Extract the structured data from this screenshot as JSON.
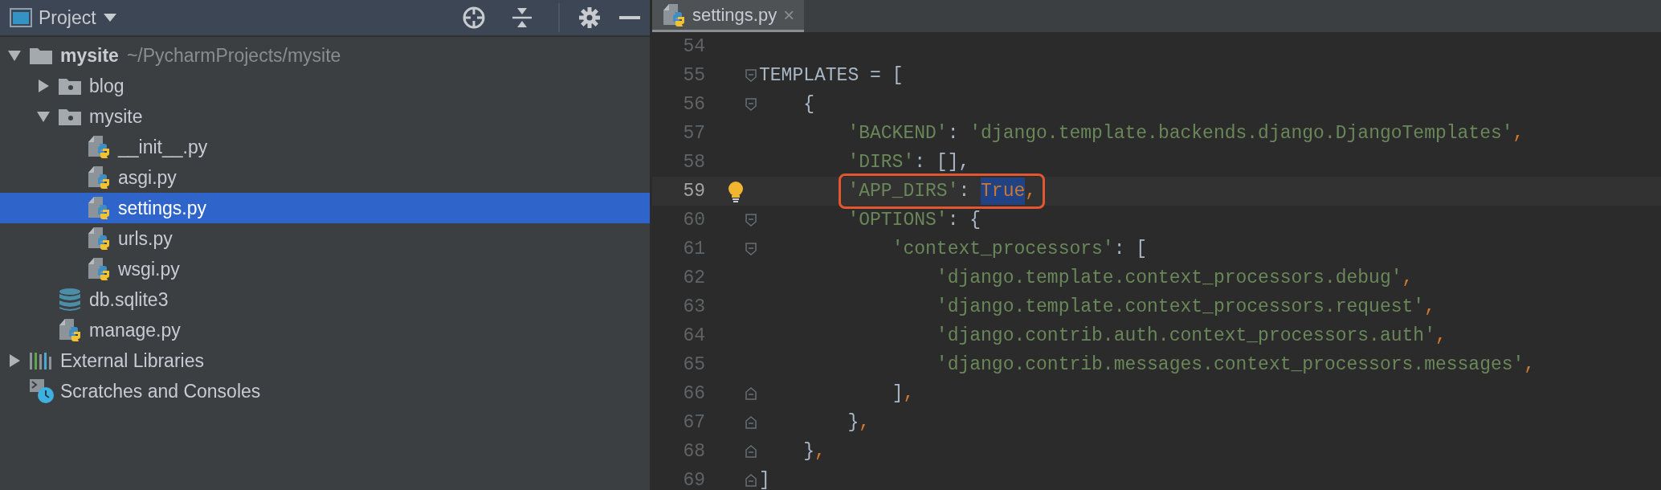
{
  "project_panel": {
    "title": "Project",
    "tree": [
      {
        "name": "mysite",
        "path": "~/PycharmProjects/mysite",
        "kind": "project-folder",
        "expanded": true,
        "selected": false,
        "children": [
          {
            "name": "blog",
            "kind": "package-folder",
            "expanded": false,
            "selected": false
          },
          {
            "name": "mysite",
            "kind": "package-folder",
            "expanded": true,
            "selected": false,
            "children": [
              {
                "name": "__init__.py",
                "kind": "python-file",
                "selected": false
              },
              {
                "name": "asgi.py",
                "kind": "python-file",
                "selected": false
              },
              {
                "name": "settings.py",
                "kind": "python-file",
                "selected": true
              },
              {
                "name": "urls.py",
                "kind": "python-file",
                "selected": false
              },
              {
                "name": "wsgi.py",
                "kind": "python-file",
                "selected": false
              }
            ]
          },
          {
            "name": "db.sqlite3",
            "kind": "database",
            "selected": false
          },
          {
            "name": "manage.py",
            "kind": "python-file",
            "selected": false
          }
        ]
      },
      {
        "name": "External Libraries",
        "kind": "libraries",
        "expanded": false,
        "selected": false
      },
      {
        "name": "Scratches and Consoles",
        "kind": "scratches",
        "selected": false
      }
    ]
  },
  "editor": {
    "tabs": [
      {
        "label": "settings.py",
        "close": "×",
        "selected": true
      }
    ],
    "lines": [
      {
        "number": "54"
      },
      {
        "number": "55",
        "fold_open": true,
        "tokens": [
          {
            "kind": "plain",
            "text": "TEMPLATES = ["
          }
        ]
      },
      {
        "number": "56",
        "fold_open": true,
        "tokens": [
          {
            "kind": "plain",
            "text": "{"
          }
        ]
      },
      {
        "number": "57",
        "tokens": [
          {
            "kind": "string",
            "text": "'BACKEND'"
          },
          {
            "kind": "plain",
            "text": ": "
          },
          {
            "kind": "string",
            "text": "'django.template.backends.django.DjangoTemplates'"
          },
          {
            "kind": "keyword",
            "text": ","
          }
        ]
      },
      {
        "number": "58",
        "tokens": [
          {
            "kind": "string",
            "text": "'DIRS'"
          },
          {
            "kind": "plain",
            "text": ": [],"
          }
        ]
      },
      {
        "number": "59",
        "current": true,
        "bulb": true,
        "callout": true,
        "tokens": [
          {
            "kind": "string",
            "text": "'APP_DIRS'"
          },
          {
            "kind": "plain",
            "text": ": "
          },
          {
            "kind": "selection",
            "text": "True"
          },
          {
            "kind": "keyword",
            "text": ","
          }
        ]
      },
      {
        "number": "60",
        "fold_open": true,
        "tokens": [
          {
            "kind": "string",
            "text": "'OPTIONS'"
          },
          {
            "kind": "plain",
            "text": ": {"
          }
        ]
      },
      {
        "number": "61",
        "fold_open": true,
        "tokens": [
          {
            "kind": "string",
            "text": "'context_processors'"
          },
          {
            "kind": "plain",
            "text": ": ["
          }
        ]
      },
      {
        "number": "62",
        "tokens": [
          {
            "kind": "string",
            "text": "'django.template.context_processors.debug'"
          },
          {
            "kind": "keyword",
            "text": ","
          }
        ]
      },
      {
        "number": "63",
        "tokens": [
          {
            "kind": "string",
            "text": "'django.template.context_processors.request'"
          },
          {
            "kind": "keyword",
            "text": ","
          }
        ]
      },
      {
        "number": "64",
        "tokens": [
          {
            "kind": "string",
            "text": "'django.contrib.auth.context_processors.auth'"
          },
          {
            "kind": "keyword",
            "text": ","
          }
        ]
      },
      {
        "number": "65",
        "tokens": [
          {
            "kind": "string",
            "text": "'django.contrib.messages.context_processors.messages'"
          },
          {
            "kind": "keyword",
            "text": ","
          }
        ]
      },
      {
        "number": "66",
        "fold_close": true,
        "tokens": [
          {
            "kind": "plain",
            "text": "]"
          },
          {
            "kind": "keyword",
            "text": ","
          }
        ]
      },
      {
        "number": "67",
        "fold_close": true,
        "tokens": [
          {
            "kind": "plain",
            "text": "}"
          },
          {
            "kind": "keyword",
            "text": ","
          }
        ]
      },
      {
        "number": "68",
        "fold_close": true,
        "tokens": [
          {
            "kind": "plain",
            "text": "}"
          },
          {
            "kind": "keyword",
            "text": ","
          }
        ]
      },
      {
        "number": "69",
        "fold_close": true,
        "tokens": [
          {
            "kind": "plain",
            "text": "]"
          }
        ]
      }
    ]
  }
}
